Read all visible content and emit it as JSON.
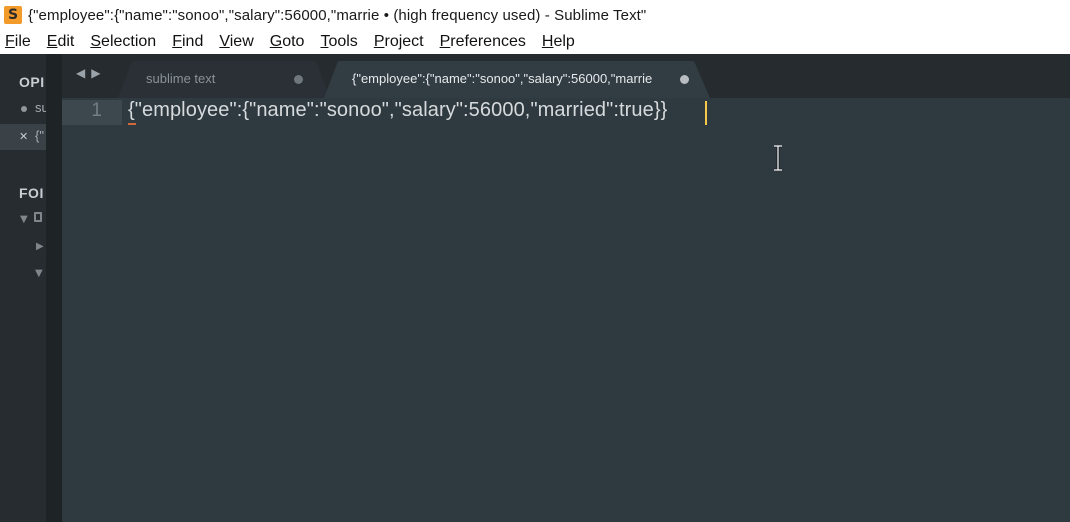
{
  "window": {
    "title": "{\"employee\":{\"name\":\"sonoo\",\"salary\":56000,\"marrie • (high frequency used) - Sublime Text\"",
    "app_icon": "sublime-text-logo-icon",
    "accent": "#f29b2a"
  },
  "menu": {
    "items": [
      "File",
      "Edit",
      "Selection",
      "Find",
      "View",
      "Goto",
      "Tools",
      "Project",
      "Preferences",
      "Help"
    ]
  },
  "sidebar": {
    "open_files_header": "OPI",
    "open_files": [
      {
        "label": "su",
        "state": "inactive"
      },
      {
        "label": "{\"",
        "state": "active"
      }
    ],
    "folders_header": "FOI"
  },
  "tabs": [
    {
      "label": "sublime text",
      "dirty": true,
      "active": false
    },
    {
      "label": "{\"employee\":{\"name\":\"sonoo\",\"salary\":56000,\"marrie",
      "dirty": true,
      "active": true
    }
  ],
  "editor": {
    "line_numbers": [
      "1"
    ],
    "lines": [
      "{\"employee\":{\"name\":\"sonoo\",\"salary\":56000,\"married\":true}}"
    ],
    "background": "#2f3a40",
    "caret_color": "#f7c84a"
  }
}
